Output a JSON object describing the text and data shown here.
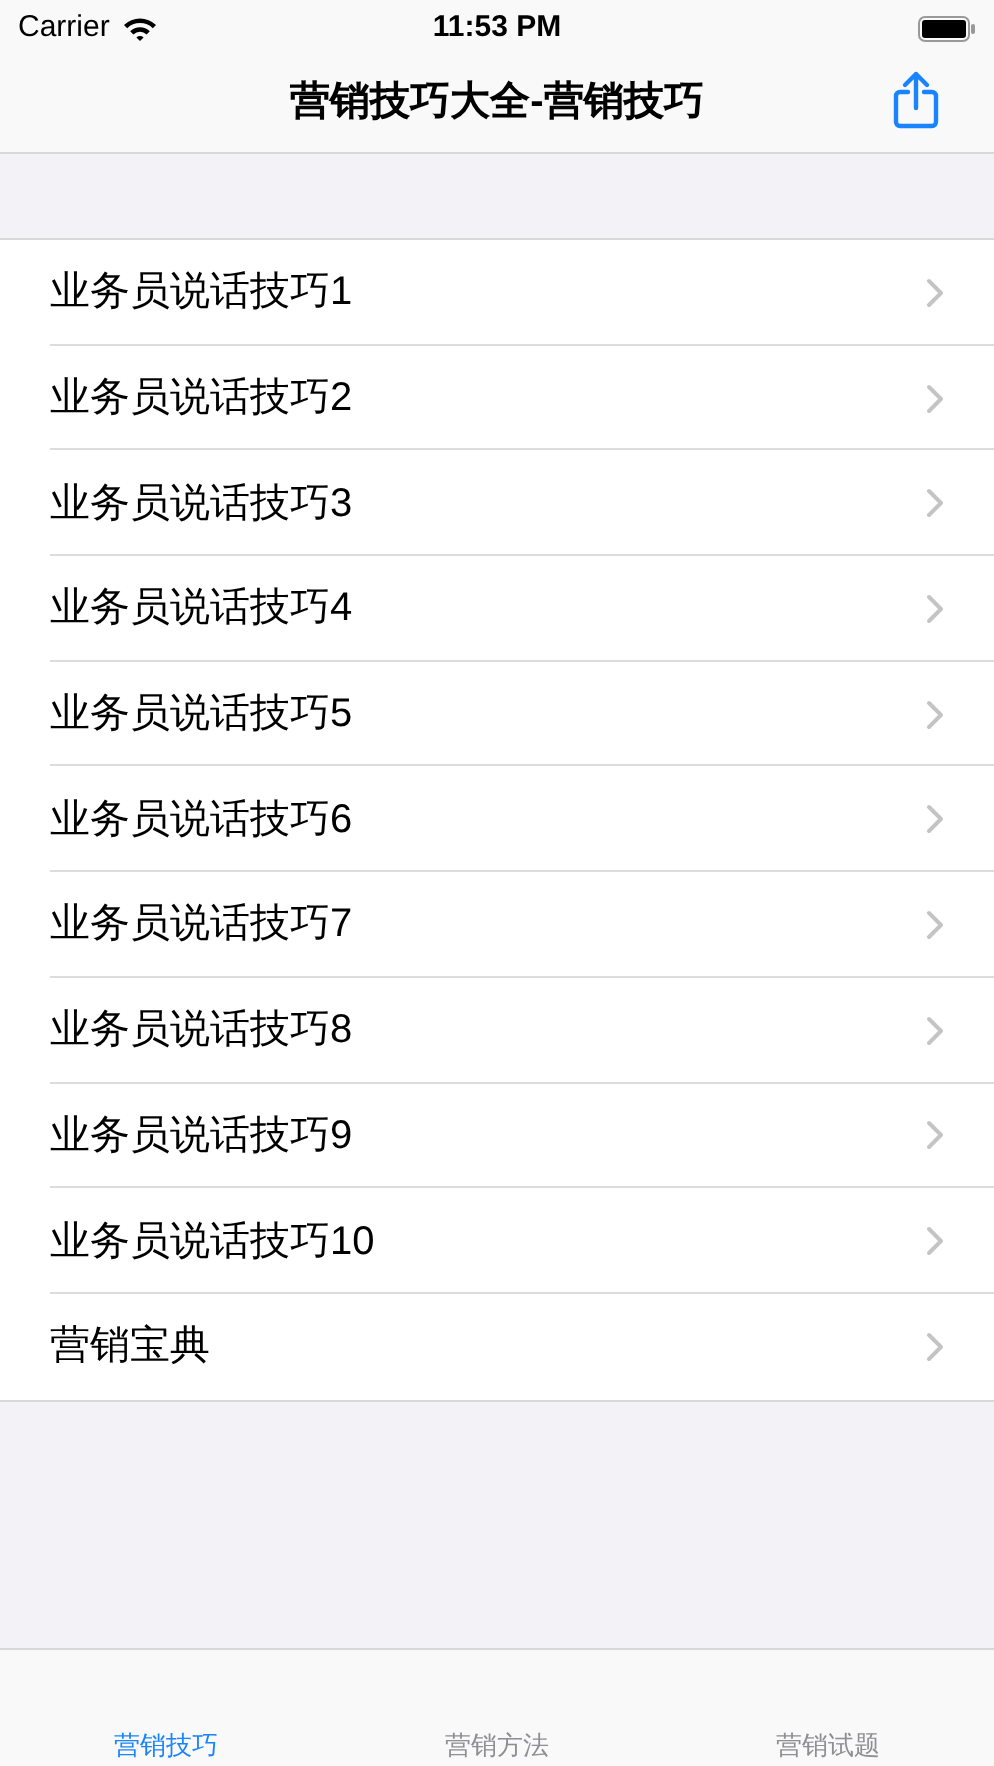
{
  "status_bar": {
    "carrier": "Carrier",
    "time": "11:53 PM"
  },
  "nav_bar": {
    "title": "营销技巧大全-营销技巧"
  },
  "list": [
    {
      "label": "业务员说话技巧1"
    },
    {
      "label": "业务员说话技巧2"
    },
    {
      "label": "业务员说话技巧3"
    },
    {
      "label": "业务员说话技巧4"
    },
    {
      "label": "业务员说话技巧5"
    },
    {
      "label": "业务员说话技巧6"
    },
    {
      "label": "业务员说话技巧7"
    },
    {
      "label": "业务员说话技巧8"
    },
    {
      "label": "业务员说话技巧9"
    },
    {
      "label": "业务员说话技巧10"
    },
    {
      "label": "营销宝典"
    }
  ],
  "tabs": [
    {
      "label": "营销技巧",
      "selected": true
    },
    {
      "label": "营销方法",
      "selected": false
    },
    {
      "label": "营销试题",
      "selected": false
    }
  ]
}
